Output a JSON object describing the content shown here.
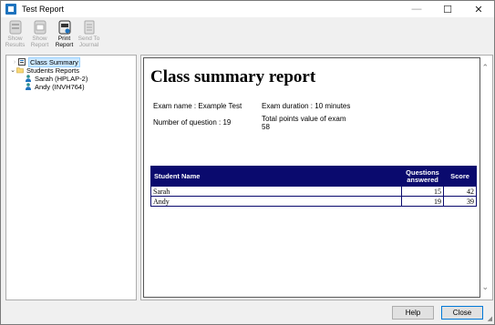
{
  "window": {
    "title": "Test Report",
    "controls": {
      "minimize": "—",
      "maximize": "☐",
      "close": "✕"
    }
  },
  "toolbar": {
    "items": [
      {
        "label": "Show\nResults",
        "icon": "show-results-icon",
        "enabled": false
      },
      {
        "label": "Show\nReport",
        "icon": "show-report-icon",
        "enabled": false
      },
      {
        "label": "Print\nReport",
        "icon": "print-icon",
        "enabled": true
      },
      {
        "label": "Send To\nJournal",
        "icon": "journal-icon",
        "enabled": false
      }
    ]
  },
  "tree": {
    "class_summary": "Class Summary",
    "students_reports": "Students Reports",
    "students": [
      {
        "label": "Sarah (HPLAP-2)"
      },
      {
        "label": "Andy (INVH764)"
      }
    ],
    "expander_collapsed": "›",
    "expander_expanded": "⌄"
  },
  "report": {
    "title": "Class summary report",
    "exam_name": "Exam name : Example Test",
    "exam_duration": "Exam duration : 10 minutes",
    "num_questions": "Number of question : 19",
    "total_points_label": "Total points value of exam",
    "total_points_value": "58",
    "table": {
      "headers": {
        "name": "Student Name",
        "answered": "Questions answered",
        "score": "Score"
      },
      "rows": [
        {
          "name": "Sarah",
          "answered": "15",
          "score": "42"
        },
        {
          "name": "Andy",
          "answered": "19",
          "score": "39"
        }
      ]
    },
    "scroll_up": "⌃",
    "scroll_down": "⌄"
  },
  "buttons": {
    "help": "Help",
    "close": "Close"
  },
  "colors": {
    "table_header": "#0a0a6e",
    "selection": "#cce8ff",
    "accent": "#0078d7"
  }
}
